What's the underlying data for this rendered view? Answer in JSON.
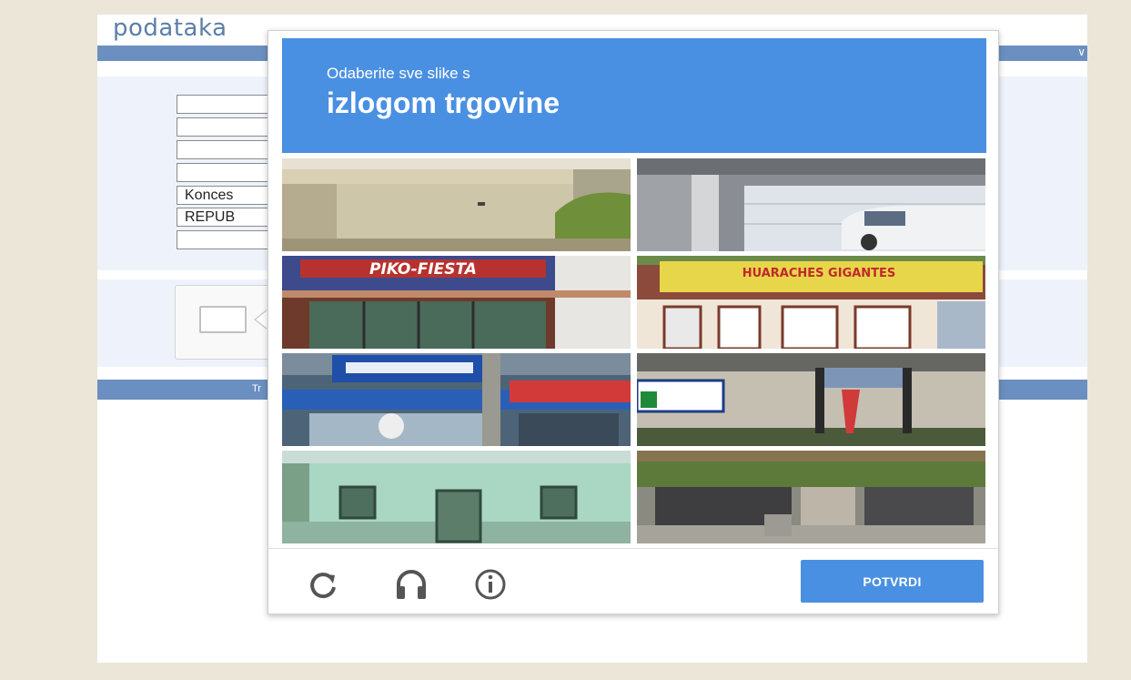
{
  "page": {
    "title": "podataka",
    "form_fields": [
      {
        "value": ""
      },
      {
        "value": ""
      },
      {
        "value": ""
      },
      {
        "value": ""
      },
      {
        "value": "Konces"
      },
      {
        "value": "REPUB"
      },
      {
        "value": ""
      }
    ],
    "bottom_bar_text": "Tr"
  },
  "captcha": {
    "instruction": "Odaberite sve slike s",
    "target": "izlogom trgovine",
    "tiles": [
      {
        "name": "tile-building-wall",
        "shop_sign": ""
      },
      {
        "name": "tile-garage-car",
        "shop_sign": ""
      },
      {
        "name": "tile-piko-fiesta-shop",
        "shop_sign": "PIKO-FIESTA"
      },
      {
        "name": "tile-huaraches-gigantes-shop",
        "shop_sign": "HUARACHES GIGANTES"
      },
      {
        "name": "tile-storefront-sign",
        "shop_sign": ""
      },
      {
        "name": "tile-roadside-sign",
        "shop_sign": ""
      },
      {
        "name": "tile-green-house",
        "shop_sign": ""
      },
      {
        "name": "tile-hedge-fence",
        "shop_sign": ""
      }
    ],
    "icons": [
      "reload-icon",
      "audio-icon",
      "info-icon"
    ],
    "verify_label": "POTVRDI"
  },
  "colors": {
    "accent": "#4a90e2",
    "page_bar": "#6b8fc0",
    "backdrop": "#ebe6d8"
  }
}
